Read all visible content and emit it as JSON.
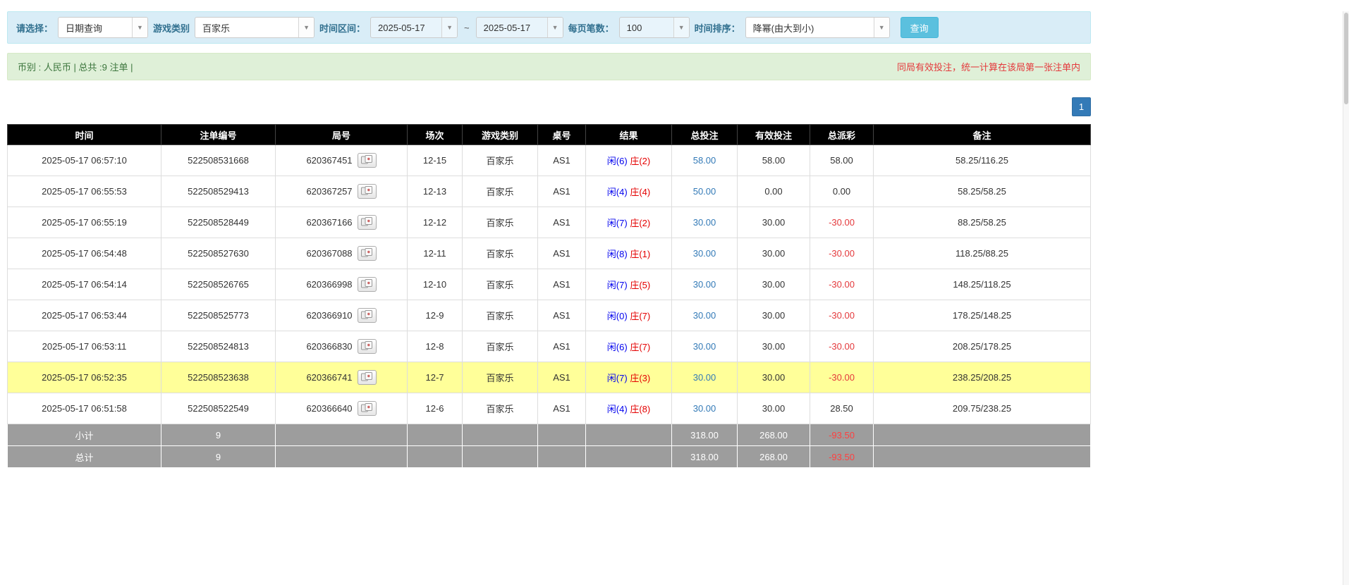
{
  "filters": {
    "select_label": "请选择：",
    "query_type": "日期查询",
    "game_type_label": "游戏类别",
    "game_type": "百家乐",
    "time_range_label": "时间区间：",
    "date_from": "2025-05-17",
    "range_separator": "~",
    "date_to": "2025-05-17",
    "page_size_label": "每页笔数：",
    "page_size": "100",
    "sort_label": "时间排序：",
    "sort_order": "降幂(由大到小)",
    "search_button": "查询"
  },
  "summary": {
    "currency_info": "币别 : 人民币 | 总共 :9 注单 |",
    "notice": "同局有效投注，统一计算在该局第一张注单内"
  },
  "pagination": {
    "current_page": "1"
  },
  "table": {
    "headers": [
      "时间",
      "注单编号",
      "局号",
      "场次",
      "游戏类别",
      "桌号",
      "结果",
      "总投注",
      "有效投注",
      "总派彩",
      "备注"
    ],
    "rows": [
      {
        "time": "2025-05-17 06:57:10",
        "bet_id": "522508531668",
        "round_no": "620367451",
        "session": "12-15",
        "game": "百家乐",
        "table_no": "AS1",
        "player": "闲(6)",
        "banker": "庄(2)",
        "total_bet": "58.00",
        "valid_bet": "58.00",
        "payout": "58.00",
        "remark": "58.25/116.25",
        "highlight": false
      },
      {
        "time": "2025-05-17 06:55:53",
        "bet_id": "522508529413",
        "round_no": "620367257",
        "session": "12-13",
        "game": "百家乐",
        "table_no": "AS1",
        "player": "闲(4)",
        "banker": "庄(4)",
        "total_bet": "50.00",
        "valid_bet": "0.00",
        "payout": "0.00",
        "remark": "58.25/58.25",
        "highlight": false
      },
      {
        "time": "2025-05-17 06:55:19",
        "bet_id": "522508528449",
        "round_no": "620367166",
        "session": "12-12",
        "game": "百家乐",
        "table_no": "AS1",
        "player": "闲(7)",
        "banker": "庄(2)",
        "total_bet": "30.00",
        "valid_bet": "30.00",
        "payout": "-30.00",
        "remark": "88.25/58.25",
        "highlight": false
      },
      {
        "time": "2025-05-17 06:54:48",
        "bet_id": "522508527630",
        "round_no": "620367088",
        "session": "12-11",
        "game": "百家乐",
        "table_no": "AS1",
        "player": "闲(8)",
        "banker": "庄(1)",
        "total_bet": "30.00",
        "valid_bet": "30.00",
        "payout": "-30.00",
        "remark": "118.25/88.25",
        "highlight": false
      },
      {
        "time": "2025-05-17 06:54:14",
        "bet_id": "522508526765",
        "round_no": "620366998",
        "session": "12-10",
        "game": "百家乐",
        "table_no": "AS1",
        "player": "闲(7)",
        "banker": "庄(5)",
        "total_bet": "30.00",
        "valid_bet": "30.00",
        "payout": "-30.00",
        "remark": "148.25/118.25",
        "highlight": false
      },
      {
        "time": "2025-05-17 06:53:44",
        "bet_id": "522508525773",
        "round_no": "620366910",
        "session": "12-9",
        "game": "百家乐",
        "table_no": "AS1",
        "player": "闲(0)",
        "banker": "庄(7)",
        "total_bet": "30.00",
        "valid_bet": "30.00",
        "payout": "-30.00",
        "remark": "178.25/148.25",
        "highlight": false
      },
      {
        "time": "2025-05-17 06:53:11",
        "bet_id": "522508524813",
        "round_no": "620366830",
        "session": "12-8",
        "game": "百家乐",
        "table_no": "AS1",
        "player": "闲(6)",
        "banker": "庄(7)",
        "total_bet": "30.00",
        "valid_bet": "30.00",
        "payout": "-30.00",
        "remark": "208.25/178.25",
        "highlight": false
      },
      {
        "time": "2025-05-17 06:52:35",
        "bet_id": "522508523638",
        "round_no": "620366741",
        "session": "12-7",
        "game": "百家乐",
        "table_no": "AS1",
        "player": "闲(7)",
        "banker": "庄(3)",
        "total_bet": "30.00",
        "valid_bet": "30.00",
        "payout": "-30.00",
        "remark": "238.25/208.25",
        "highlight": true
      },
      {
        "time": "2025-05-17 06:51:58",
        "bet_id": "522508522549",
        "round_no": "620366640",
        "session": "12-6",
        "game": "百家乐",
        "table_no": "AS1",
        "player": "闲(4)",
        "banker": "庄(8)",
        "total_bet": "30.00",
        "valid_bet": "30.00",
        "payout": "28.50",
        "remark": "209.75/238.25",
        "highlight": false
      }
    ],
    "footer_rows": [
      {
        "label": "小计",
        "count": "9",
        "total_bet": "318.00",
        "valid_bet": "268.00",
        "payout": "-93.50"
      },
      {
        "label": "总计",
        "count": "9",
        "total_bet": "318.00",
        "valid_bet": "268.00",
        "payout": "-93.50"
      }
    ]
  },
  "colors": {
    "accent_blue": "#337ab7",
    "player_blue": "#0000ee",
    "banker_red": "#e40000",
    "negative_red": "#e4393c",
    "header_bg": "#000000",
    "highlight_yellow": "#ffff99",
    "footer_gray": "#9d9d9d",
    "filter_bar_bg": "#d9edf7",
    "summary_bar_bg": "#dff0d8",
    "search_button_bg": "#5bc0de"
  }
}
